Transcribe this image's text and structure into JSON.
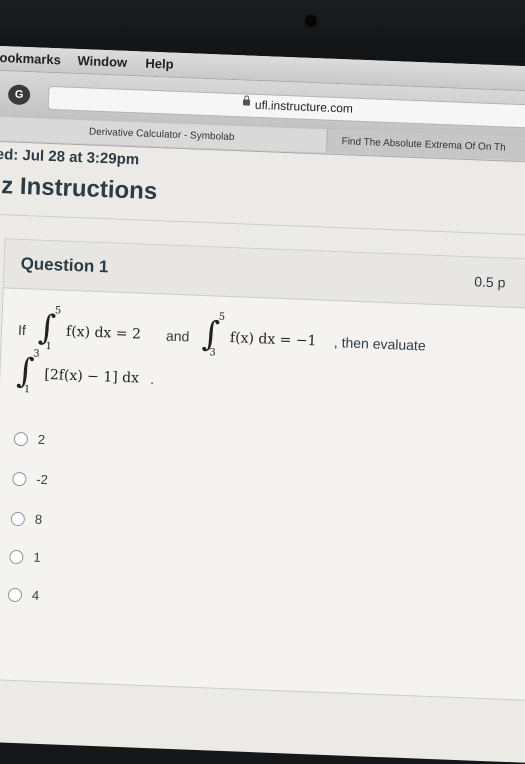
{
  "menubar": {
    "items": [
      "ookmarks",
      "Window",
      "Help"
    ]
  },
  "toolbar": {
    "extension_icon_letter": "G",
    "url": "ufl.instructure.com"
  },
  "tabs": [
    {
      "label": "Derivative Calculator - Symbolab"
    },
    {
      "label": "Find The Absolute Extrema Of On Th"
    }
  ],
  "quiz": {
    "due": "ed: Jul 28 at 3:29pm",
    "title": "iz Instructions"
  },
  "question": {
    "title": "Question 1",
    "points": "0.5 p",
    "text": {
      "if": "If",
      "and": "and",
      "then": ", then evaluate",
      "period": "."
    },
    "integral1": {
      "upper": "5",
      "lower": "1",
      "expr": "f(x) dx = 2"
    },
    "integral2": {
      "upper": "5",
      "lower": "3",
      "expr": "f(x) dx = −1"
    },
    "integral3": {
      "upper": "3",
      "lower": "1",
      "expr": "[2f(x) − 1] dx"
    },
    "answers": [
      {
        "label": "2"
      },
      {
        "label": "-2"
      },
      {
        "label": "8"
      },
      {
        "label": "1"
      },
      {
        "label": "4"
      }
    ]
  }
}
